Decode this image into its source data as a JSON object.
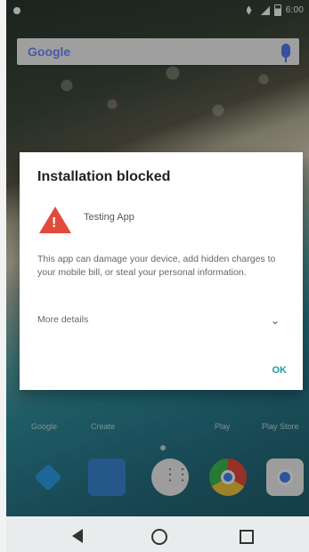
{
  "status_bar": {
    "time": "6:00"
  },
  "search": {
    "brand": "Google"
  },
  "dialog": {
    "title": "Installation blocked",
    "app_name": "Testing App",
    "message": "This app can damage your device, add hidden charges to your mobile bill, or steal your personal information.",
    "more_details_label": "More details",
    "ok_label": "OK"
  },
  "home": {
    "labels": [
      "Google",
      "Create",
      "Play",
      "Play Store"
    ]
  },
  "colors": {
    "warning_red": "#e24b3b",
    "accent_teal": "#1f9fa0",
    "google_blue": "#4285f4"
  }
}
